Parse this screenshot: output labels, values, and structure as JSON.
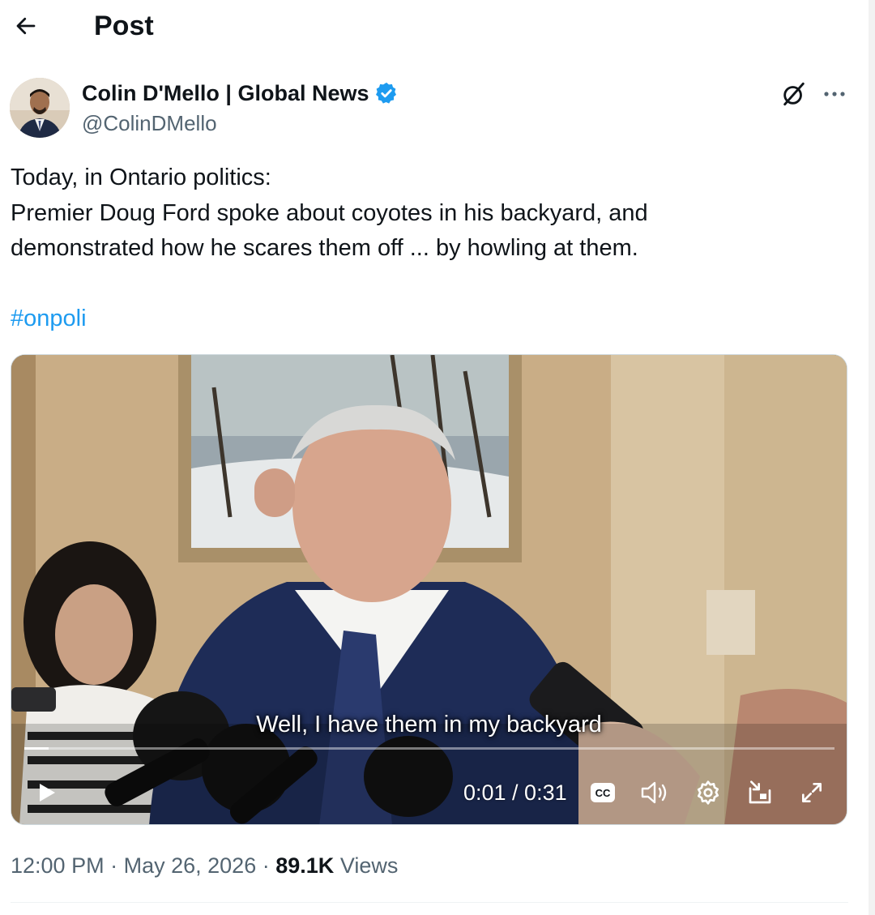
{
  "header": {
    "title": "Post"
  },
  "author": {
    "name": "Colin D'Mello | Global News",
    "handle": "@ColinDMello",
    "verified": true
  },
  "post": {
    "lines": [
      "Today, in Ontario politics:",
      "Premier Doug Ford spoke about coyotes in his backyard, and",
      "demonstrated how he scares them off ... by howling at them."
    ],
    "hashtag": "#onpoli"
  },
  "video": {
    "caption": "Well, I have them in my backyard",
    "time": "0:01 / 0:31",
    "progress_fraction": 0.03,
    "cc_label": "CC"
  },
  "meta": {
    "time": "12:00 PM",
    "separator": "·",
    "date": "May 26, 2026",
    "views_count": "89.1K",
    "views_label": "Views"
  },
  "colors": {
    "accent": "#1d9bf0",
    "text": "#0f1419",
    "secondary": "#536471"
  },
  "icons": {
    "back": "arrow-left-icon",
    "verified": "verified-badge-icon",
    "grok": "grok-icon",
    "more": "more-icon",
    "play": "play-icon",
    "volume": "volume-icon",
    "settings": "settings-icon",
    "pip": "pip-icon",
    "fullscreen": "fullscreen-icon"
  }
}
